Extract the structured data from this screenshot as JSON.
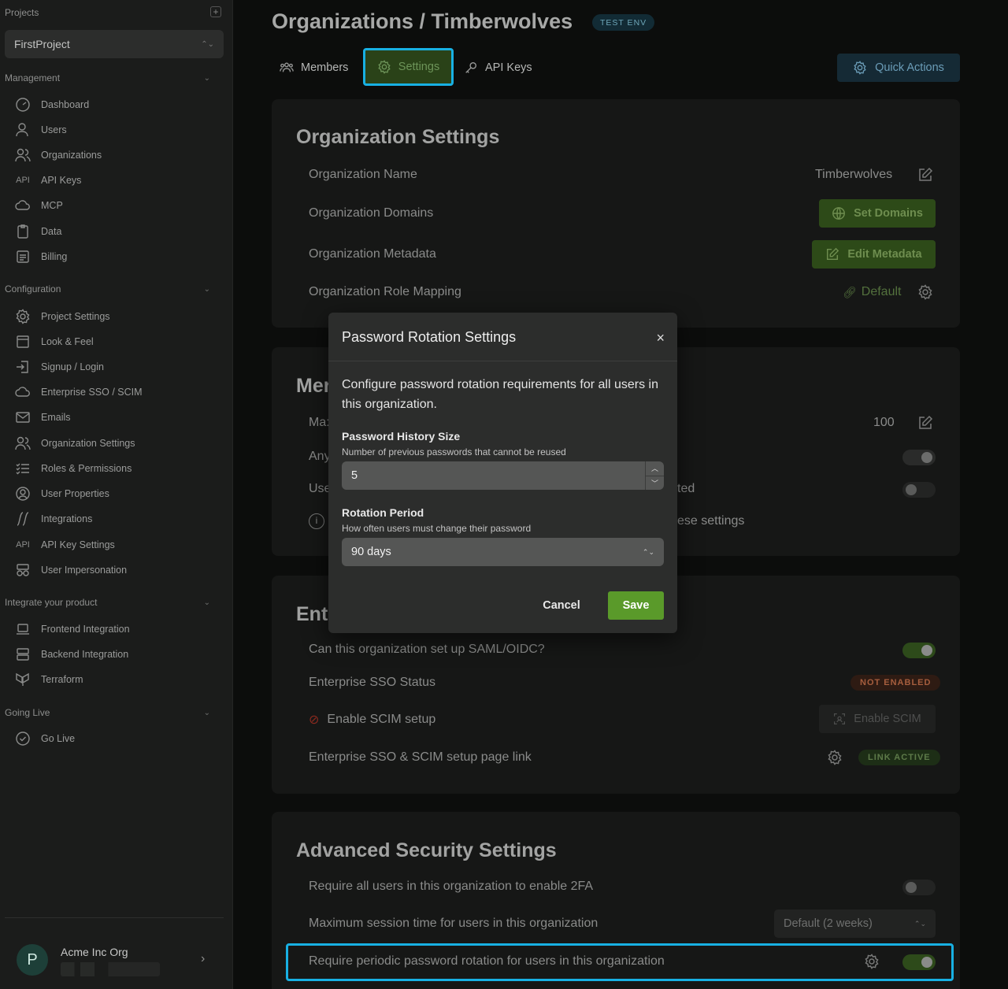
{
  "sidebar": {
    "projects_label": "Projects",
    "project_name": "FirstProject",
    "sections": {
      "management": "Management",
      "configuration": "Configuration",
      "integrate": "Integrate your product",
      "going_live": "Going Live"
    },
    "management_items": [
      "Dashboard",
      "Users",
      "Organizations",
      "API Keys",
      "MCP",
      "Data",
      "Billing"
    ],
    "configuration_items": [
      "Project Settings",
      "Look & Feel",
      "Signup / Login",
      "Enterprise SSO / SCIM",
      "Emails",
      "Organization Settings",
      "Roles & Permissions",
      "User Properties",
      "Integrations",
      "API Key Settings",
      "User Impersonation"
    ],
    "integrate_items": [
      "Frontend Integration",
      "Backend Integration",
      "Terraform"
    ],
    "going_live_items": [
      "Go Live"
    ],
    "api_icon_text": "API",
    "org": {
      "initial": "P",
      "name": "Acme Inc Org"
    }
  },
  "header": {
    "title": "Organizations / Timberwolves",
    "env_badge": "TEST ENV",
    "tabs": [
      "Members",
      "Settings",
      "API Keys"
    ],
    "active_tab": "Settings",
    "quick_actions": "Quick Actions"
  },
  "org_settings": {
    "title": "Organization Settings",
    "name_label": "Organization Name",
    "name_value": "Timberwolves",
    "domains_label": "Organization Domains",
    "set_domains": "Set Domains",
    "metadata_label": "Organization Metadata",
    "edit_metadata": "Edit Metadata",
    "role_mapping_label": "Organization Role Mapping",
    "role_mapping_value": "Default"
  },
  "members_card": {
    "title_partial": "Mer",
    "row1_partial": "Ma:",
    "row1_value": "100",
    "row2_partial": "Any",
    "row3_partial": "Use",
    "row3_tail": "ted",
    "row4_tail": "ese settings"
  },
  "enterprise_card": {
    "title_partial": "Ent",
    "saml_label": "Can this organization set up SAML/OIDC?",
    "sso_status_label": "Enterprise SSO Status",
    "sso_status_badge": "NOT ENABLED",
    "scim_label": "Enable SCIM setup",
    "scim_button": "Enable SCIM",
    "link_label": "Enterprise SSO & SCIM setup page link",
    "link_badge": "LINK ACTIVE"
  },
  "advanced_card": {
    "title": "Advanced Security Settings",
    "twofa_label": "Require all users in this organization to enable 2FA",
    "session_label": "Maximum session time for users in this organization",
    "session_value": "Default (2 weeks)",
    "rotation_label": "Require periodic password rotation for users in this organization"
  },
  "modal": {
    "title": "Password Rotation Settings",
    "close": "×",
    "description": "Configure password rotation requirements for all users in this organization.",
    "history_label": "Password History Size",
    "history_help": "Number of previous passwords that cannot be reused",
    "history_value": "5",
    "period_label": "Rotation Period",
    "period_help": "How often users must change their password",
    "period_value": "90 days",
    "cancel": "Cancel",
    "save": "Save"
  }
}
